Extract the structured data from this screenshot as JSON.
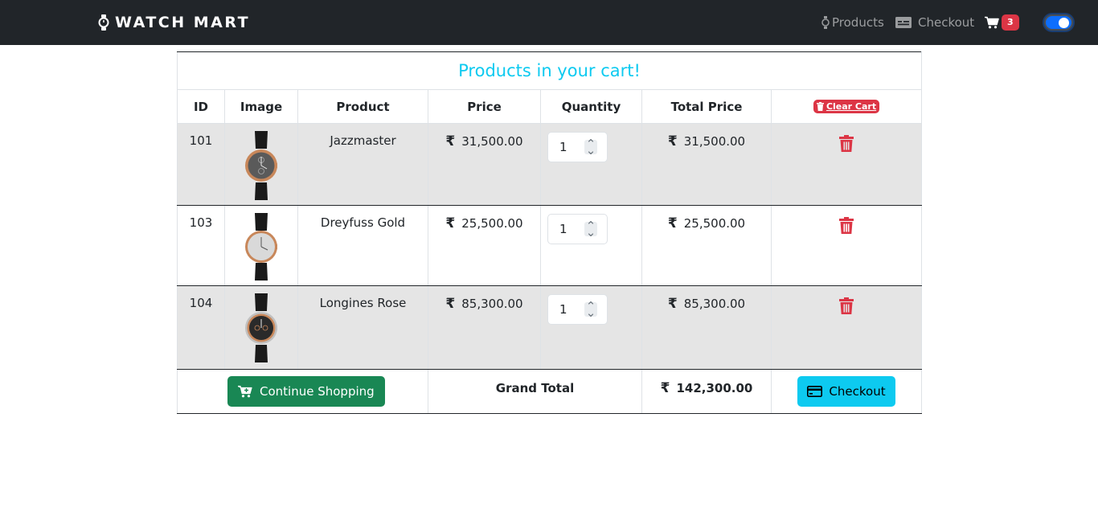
{
  "nav": {
    "brand": "WATCH MART",
    "products_label": "Products",
    "checkout_label": "Checkout",
    "cart_count": "3"
  },
  "cart": {
    "caption": "Products in your cart!",
    "headers": {
      "id": "ID",
      "image": "Image",
      "product": "Product",
      "price": "Price",
      "quantity": "Quantity",
      "total": "Total Price"
    },
    "clear_label": "Clear Cart",
    "currency_symbol": "₹",
    "items": [
      {
        "id": "101",
        "name": "Jazzmaster",
        "price": "31,500.00",
        "qty": "1",
        "total": "31,500.00",
        "dial_color": "#5a5a5a"
      },
      {
        "id": "103",
        "name": "Dreyfuss Gold",
        "price": "25,500.00",
        "qty": "1",
        "total": "25,500.00",
        "dial_color": "#d9d9d9"
      },
      {
        "id": "104",
        "name": "Longines Rose",
        "price": "85,300.00",
        "qty": "1",
        "total": "85,300.00",
        "dial_color": "#2a2a2a"
      }
    ],
    "continue_label": "Continue Shopping",
    "grand_total_label": "Grand Total",
    "grand_total": "142,300.00",
    "checkout_label": "Checkout"
  },
  "colors": {
    "navbar": "#212529",
    "accent": "#0dcaf0",
    "danger": "#dc3545",
    "success": "#198754",
    "row_shade": "#e5e5e5"
  },
  "icons": {
    "brand": "watch-icon",
    "products": "watch-icon",
    "checkout": "card-icon",
    "cart": "cart-icon",
    "clear": "trash-icon",
    "remove": "trash-icon",
    "continue": "cart-plus-icon",
    "checkout_button": "credit-card-icon"
  }
}
